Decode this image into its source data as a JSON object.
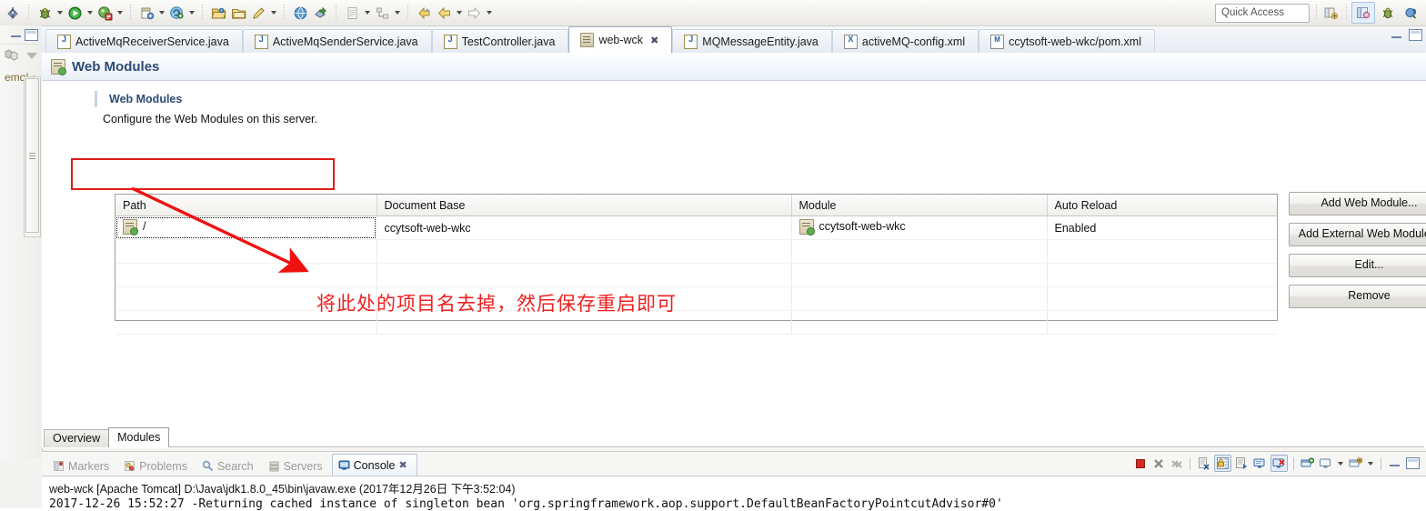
{
  "toolbar": {
    "quick_access_label": "Quick Access",
    "groups": [
      {
        "name": "debug-group",
        "items": [
          {
            "icon": "debug-icon",
            "arrow": false
          }
        ]
      },
      {
        "name": "run-group",
        "items": [
          {
            "icon": "bug-icon",
            "arrow": true
          },
          {
            "icon": "run-icon",
            "arrow": true
          },
          {
            "icon": "profile-icon",
            "arrow": true
          }
        ]
      },
      {
        "name": "new-group",
        "items": [
          {
            "icon": "new-wizard-icon",
            "arrow": true
          },
          {
            "icon": "save-all-icon",
            "arrow": true
          }
        ]
      },
      {
        "name": "resource-group",
        "items": [
          {
            "icon": "open-folder-icon",
            "arrow": false
          },
          {
            "icon": "archive-icon",
            "arrow": false
          },
          {
            "icon": "edit-pencil-icon",
            "arrow": true
          }
        ]
      },
      {
        "name": "web-group",
        "items": [
          {
            "icon": "globe-icon",
            "arrow": false
          },
          {
            "icon": "deploy-icon",
            "arrow": false
          }
        ]
      },
      {
        "name": "doc-group",
        "items": [
          {
            "icon": "document-icon",
            "arrow": true
          },
          {
            "icon": "outline-icon",
            "arrow": true
          }
        ]
      },
      {
        "name": "nav-group",
        "items": [
          {
            "icon": "back-yellow-icon",
            "arrow": false
          },
          {
            "icon": "back-arrow-icon",
            "arrow": true
          },
          {
            "icon": "forward-arrow-icon",
            "arrow": true
          }
        ]
      }
    ],
    "perspective_buttons": [
      {
        "name": "open-perspective-icon",
        "selected": false
      },
      {
        "name": "java-ee-perspective-icon",
        "selected": true
      },
      {
        "name": "debug-perspective-icon",
        "selected": false
      },
      {
        "name": "java-perspective-icon",
        "selected": false
      }
    ]
  },
  "left_rail": {
    "label": "emq!",
    "restore_tooltip": "Restore",
    "maximize_tooltip": "Maximize"
  },
  "editor_tabs": [
    {
      "label": "ActiveMqReceiverService.java",
      "icon": "java-file-icon",
      "active": false,
      "closable": false
    },
    {
      "label": "ActiveMqSenderService.java",
      "icon": "java-file-icon",
      "active": false,
      "closable": false
    },
    {
      "label": "TestController.java",
      "icon": "java-file-icon",
      "active": false,
      "closable": false
    },
    {
      "label": "web-wck",
      "icon": "server-icon",
      "active": true,
      "closable": true
    },
    {
      "label": "MQMessageEntity.java",
      "icon": "java-file-icon",
      "active": false,
      "closable": false
    },
    {
      "label": "activeMQ-config.xml",
      "icon": "xml-file-icon",
      "active": false,
      "closable": false
    },
    {
      "label": "ccytsoft-web-wkc/pom.xml",
      "icon": "pom-file-icon",
      "active": false,
      "closable": false
    }
  ],
  "editor": {
    "header_title": "Web Modules",
    "header_icon": "web-module-icon",
    "section_title": "Web Modules",
    "section_description": "Configure the Web Modules on this server.",
    "table": {
      "columns": [
        "Path",
        "Document Base",
        "Module",
        "Auto Reload"
      ],
      "rows": [
        {
          "path": "/",
          "document_base": "ccytsoft-web-wkc",
          "module": "ccytsoft-web-wkc",
          "auto_reload": "Enabled",
          "selected": true
        }
      ],
      "empty_row_count": 4
    },
    "buttons": [
      {
        "label": "Add Web Module...",
        "name": "add-web-module-button"
      },
      {
        "label": "Add External Web Module...",
        "name": "add-external-web-module-button"
      },
      {
        "label": "Edit...",
        "name": "edit-button"
      },
      {
        "label": "Remove",
        "name": "remove-button"
      }
    ],
    "annotation": {
      "text": "将此处的项目名去掉，然后保存重启即可",
      "color": "#ef2020",
      "arrow_color": "#e01b1b",
      "highlight_color": "#e01b1b"
    },
    "form_tabs": [
      {
        "label": "Overview",
        "active": false
      },
      {
        "label": "Modules",
        "active": true
      }
    ]
  },
  "console": {
    "view_tabs": [
      {
        "label": "Markers",
        "icon": "markers-icon",
        "active": false,
        "closable": false
      },
      {
        "label": "Problems",
        "icon": "problems-icon",
        "active": false,
        "closable": false
      },
      {
        "label": "Search",
        "icon": "search-icon",
        "active": false,
        "closable": false
      },
      {
        "label": "Servers",
        "icon": "servers-icon",
        "active": false,
        "closable": false
      },
      {
        "label": "Console",
        "icon": "console-icon",
        "active": true,
        "closable": true
      }
    ],
    "toolbar_buttons": [
      {
        "name": "terminate-icon",
        "selected": false
      },
      {
        "name": "remove-launch-icon",
        "selected": false
      },
      {
        "name": "remove-all-terminated-icon",
        "selected": false
      },
      {
        "name": "clear-console-icon",
        "selected": false
      },
      {
        "name": "scroll-lock-icon",
        "selected": true
      },
      {
        "name": "word-wrap-icon",
        "selected": false
      },
      {
        "name": "show-console-on-output-icon",
        "selected": false
      },
      {
        "name": "pin-console-icon",
        "selected": true
      },
      {
        "name": "new-console-view-icon",
        "selected": false
      },
      {
        "name": "display-selected-console-icon",
        "selected": false
      },
      {
        "name": "open-console-icon",
        "selected": false
      },
      {
        "name": "minimize-icon",
        "selected": false
      },
      {
        "name": "maximize-icon",
        "selected": false
      }
    ],
    "process_line": "web-wck [Apache Tomcat] D:\\Java\\jdk1.8.0_45\\bin\\javaw.exe (2017年12月26日 下午3:52:04)",
    "log_line": "2017-12-26 15:52:27 -Returning cached instance of singleton bean 'org.springframework.aop.support.DefaultBeanFactoryPointcutAdvisor#0'"
  }
}
